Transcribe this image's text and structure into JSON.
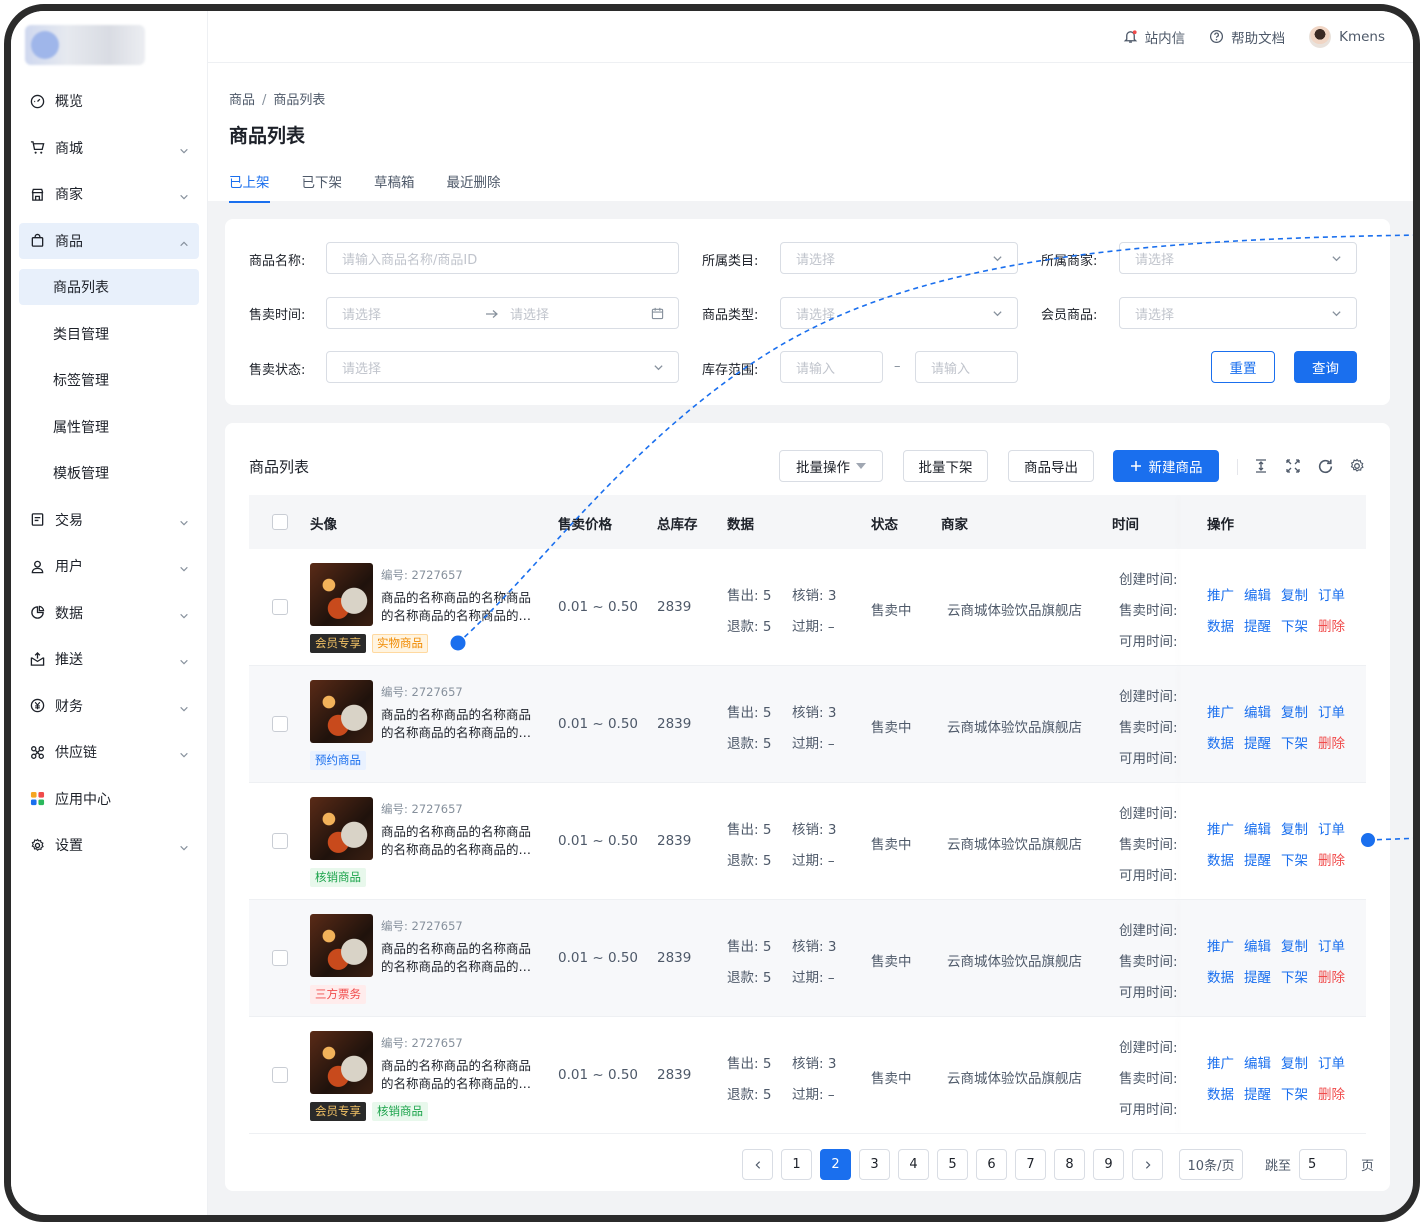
{
  "topbar": {
    "messages": "站内信",
    "help": "帮助文档",
    "user": "Kmens"
  },
  "sidebar": {
    "items": [
      {
        "label": "概览",
        "icon": "gauge-icon",
        "chevron": false
      },
      {
        "label": "商城",
        "icon": "cart-icon",
        "chevron": true
      },
      {
        "label": "商家",
        "icon": "store-icon",
        "chevron": true
      },
      {
        "label": "商品",
        "icon": "bag-icon",
        "chevron": true,
        "expanded": true
      },
      {
        "label": "商品列表",
        "sub": true,
        "selected": true
      },
      {
        "label": "类目管理",
        "sub": true
      },
      {
        "label": "标签管理",
        "sub": true
      },
      {
        "label": "属性管理",
        "sub": true
      },
      {
        "label": "模板管理",
        "sub": true
      },
      {
        "label": "交易",
        "icon": "receipt-icon",
        "chevron": true
      },
      {
        "label": "用户",
        "icon": "user-icon",
        "chevron": true
      },
      {
        "label": "数据",
        "icon": "chart-icon",
        "chevron": true
      },
      {
        "label": "推送",
        "icon": "push-icon",
        "chevron": true
      },
      {
        "label": "财务",
        "icon": "coin-icon",
        "chevron": true
      },
      {
        "label": "供应链",
        "icon": "link-icon",
        "chevron": true
      },
      {
        "label": "应用中心",
        "icon": "apps-icon",
        "chevron": false
      },
      {
        "label": "设置",
        "icon": "gear-icon",
        "chevron": true
      }
    ]
  },
  "header": {
    "breadcrumb": [
      "商品",
      "商品列表"
    ],
    "title": "商品列表",
    "tabs": [
      "已上架",
      "已下架",
      "草稿箱",
      "最近删除"
    ]
  },
  "filter": {
    "name_label": "商品名称:",
    "name_placeholder": "请输入商品名称/商品ID",
    "category_label": "所属类目:",
    "category_placeholder": "请选择",
    "merchant_label": "所属商家:",
    "merchant_placeholder": "请选择",
    "sale_time_label": "售卖时间:",
    "start_placeholder": "请选择",
    "end_placeholder": "请选择",
    "type_label": "商品类型:",
    "type_placeholder": "请选择",
    "member_label": "会员商品:",
    "member_placeholder": "请选择",
    "status_label": "售卖状态:",
    "status_placeholder": "请选择",
    "stock_label": "库存范围:",
    "stock_min_placeholder": "请输入",
    "stock_max_placeholder": "请输入",
    "stock_sep": "–",
    "reset": "重置",
    "query": "查询"
  },
  "list": {
    "title": "商品列表",
    "batch": "批量操作",
    "batch_off": "批量下架",
    "export": "商品导出",
    "create": "新建商品",
    "columns": [
      "头像",
      "售卖价格",
      "总库存",
      "数据",
      "状态",
      "商家",
      "时间",
      "操作"
    ],
    "rows": [
      {
        "id": "编号: 2727657",
        "name": "商品的名称商品的名称商品的名称商品的名称商品的…",
        "tags": [
          {
            "text": "会员专享",
            "kind": "member"
          },
          {
            "text": "实物商品",
            "kind": "phys"
          }
        ],
        "price": "0.01 ~ 0.50",
        "stock": "2839",
        "sold": "售出: 5",
        "verified": "核销: 3",
        "refund": "退款: 5",
        "expired": "过期: –",
        "status": "售卖中",
        "merchant": "云商城体验饮品旗舰店",
        "t1": "创建时间:",
        "t2": "售卖时间:",
        "t3": "可用时间:"
      },
      {
        "id": "编号: 2727657",
        "name": "商品的名称商品的名称商品的名称商品的名称商品的…",
        "tags": [
          {
            "text": "预约商品",
            "kind": "pre"
          }
        ],
        "price": "0.01 ~ 0.50",
        "stock": "2839",
        "sold": "售出: 5",
        "verified": "核销: 3",
        "refund": "退款: 5",
        "expired": "过期: –",
        "status": "售卖中",
        "merchant": "云商城体验饮品旗舰店",
        "t1": "创建时间:",
        "t2": "售卖时间:",
        "t3": "可用时间:"
      },
      {
        "id": "编号: 2727657",
        "name": "商品的名称商品的名称商品的名称商品的名称商品的…",
        "tags": [
          {
            "text": "核销商品",
            "kind": "ver"
          }
        ],
        "price": "0.01 ~ 0.50",
        "stock": "2839",
        "sold": "售出: 5",
        "verified": "核销: 3",
        "refund": "退款: 5",
        "expired": "过期: –",
        "status": "售卖中",
        "merchant": "云商城体验饮品旗舰店",
        "t1": "创建时间:",
        "t2": "售卖时间:",
        "t3": "可用时间:"
      },
      {
        "id": "编号: 2727657",
        "name": "商品的名称商品的名称商品的名称商品的名称商品的…",
        "tags": [
          {
            "text": "三方票务",
            "kind": "third"
          }
        ],
        "price": "0.01 ~ 0.50",
        "stock": "2839",
        "sold": "售出: 5",
        "verified": "核销: 3",
        "refund": "退款: 5",
        "expired": "过期: –",
        "status": "售卖中",
        "merchant": "云商城体验饮品旗舰店",
        "t1": "创建时间:",
        "t2": "售卖时间:",
        "t3": "可用时间:"
      },
      {
        "id": "编号: 2727657",
        "name": "商品的名称商品的名称商品的名称商品的名称商品的…",
        "tags": [
          {
            "text": "会员专享",
            "kind": "member"
          },
          {
            "text": "核销商品",
            "kind": "ver"
          }
        ],
        "price": "0.01 ~ 0.50",
        "stock": "2839",
        "sold": "售出: 5",
        "verified": "核销: 3",
        "refund": "退款: 5",
        "expired": "过期: –",
        "status": "售卖中",
        "merchant": "云商城体验饮品旗舰店",
        "t1": "创建时间:",
        "t2": "售卖时间:",
        "t3": "可用时间:"
      }
    ],
    "ops": [
      "推广",
      "编辑",
      "复制",
      "订单",
      "数据",
      "提醒",
      "下架",
      "删除"
    ]
  },
  "pager": {
    "prev": "<",
    "next": ">",
    "pages": [
      "1",
      "2",
      "3",
      "4",
      "5",
      "6",
      "7",
      "8",
      "9"
    ],
    "current": "2",
    "size": "10条/页",
    "jump_label": "跳至",
    "jump_value": "5",
    "page_unit": "页"
  },
  "colors": {
    "primary": "#1a6fee",
    "danger": "#f04b4b"
  }
}
